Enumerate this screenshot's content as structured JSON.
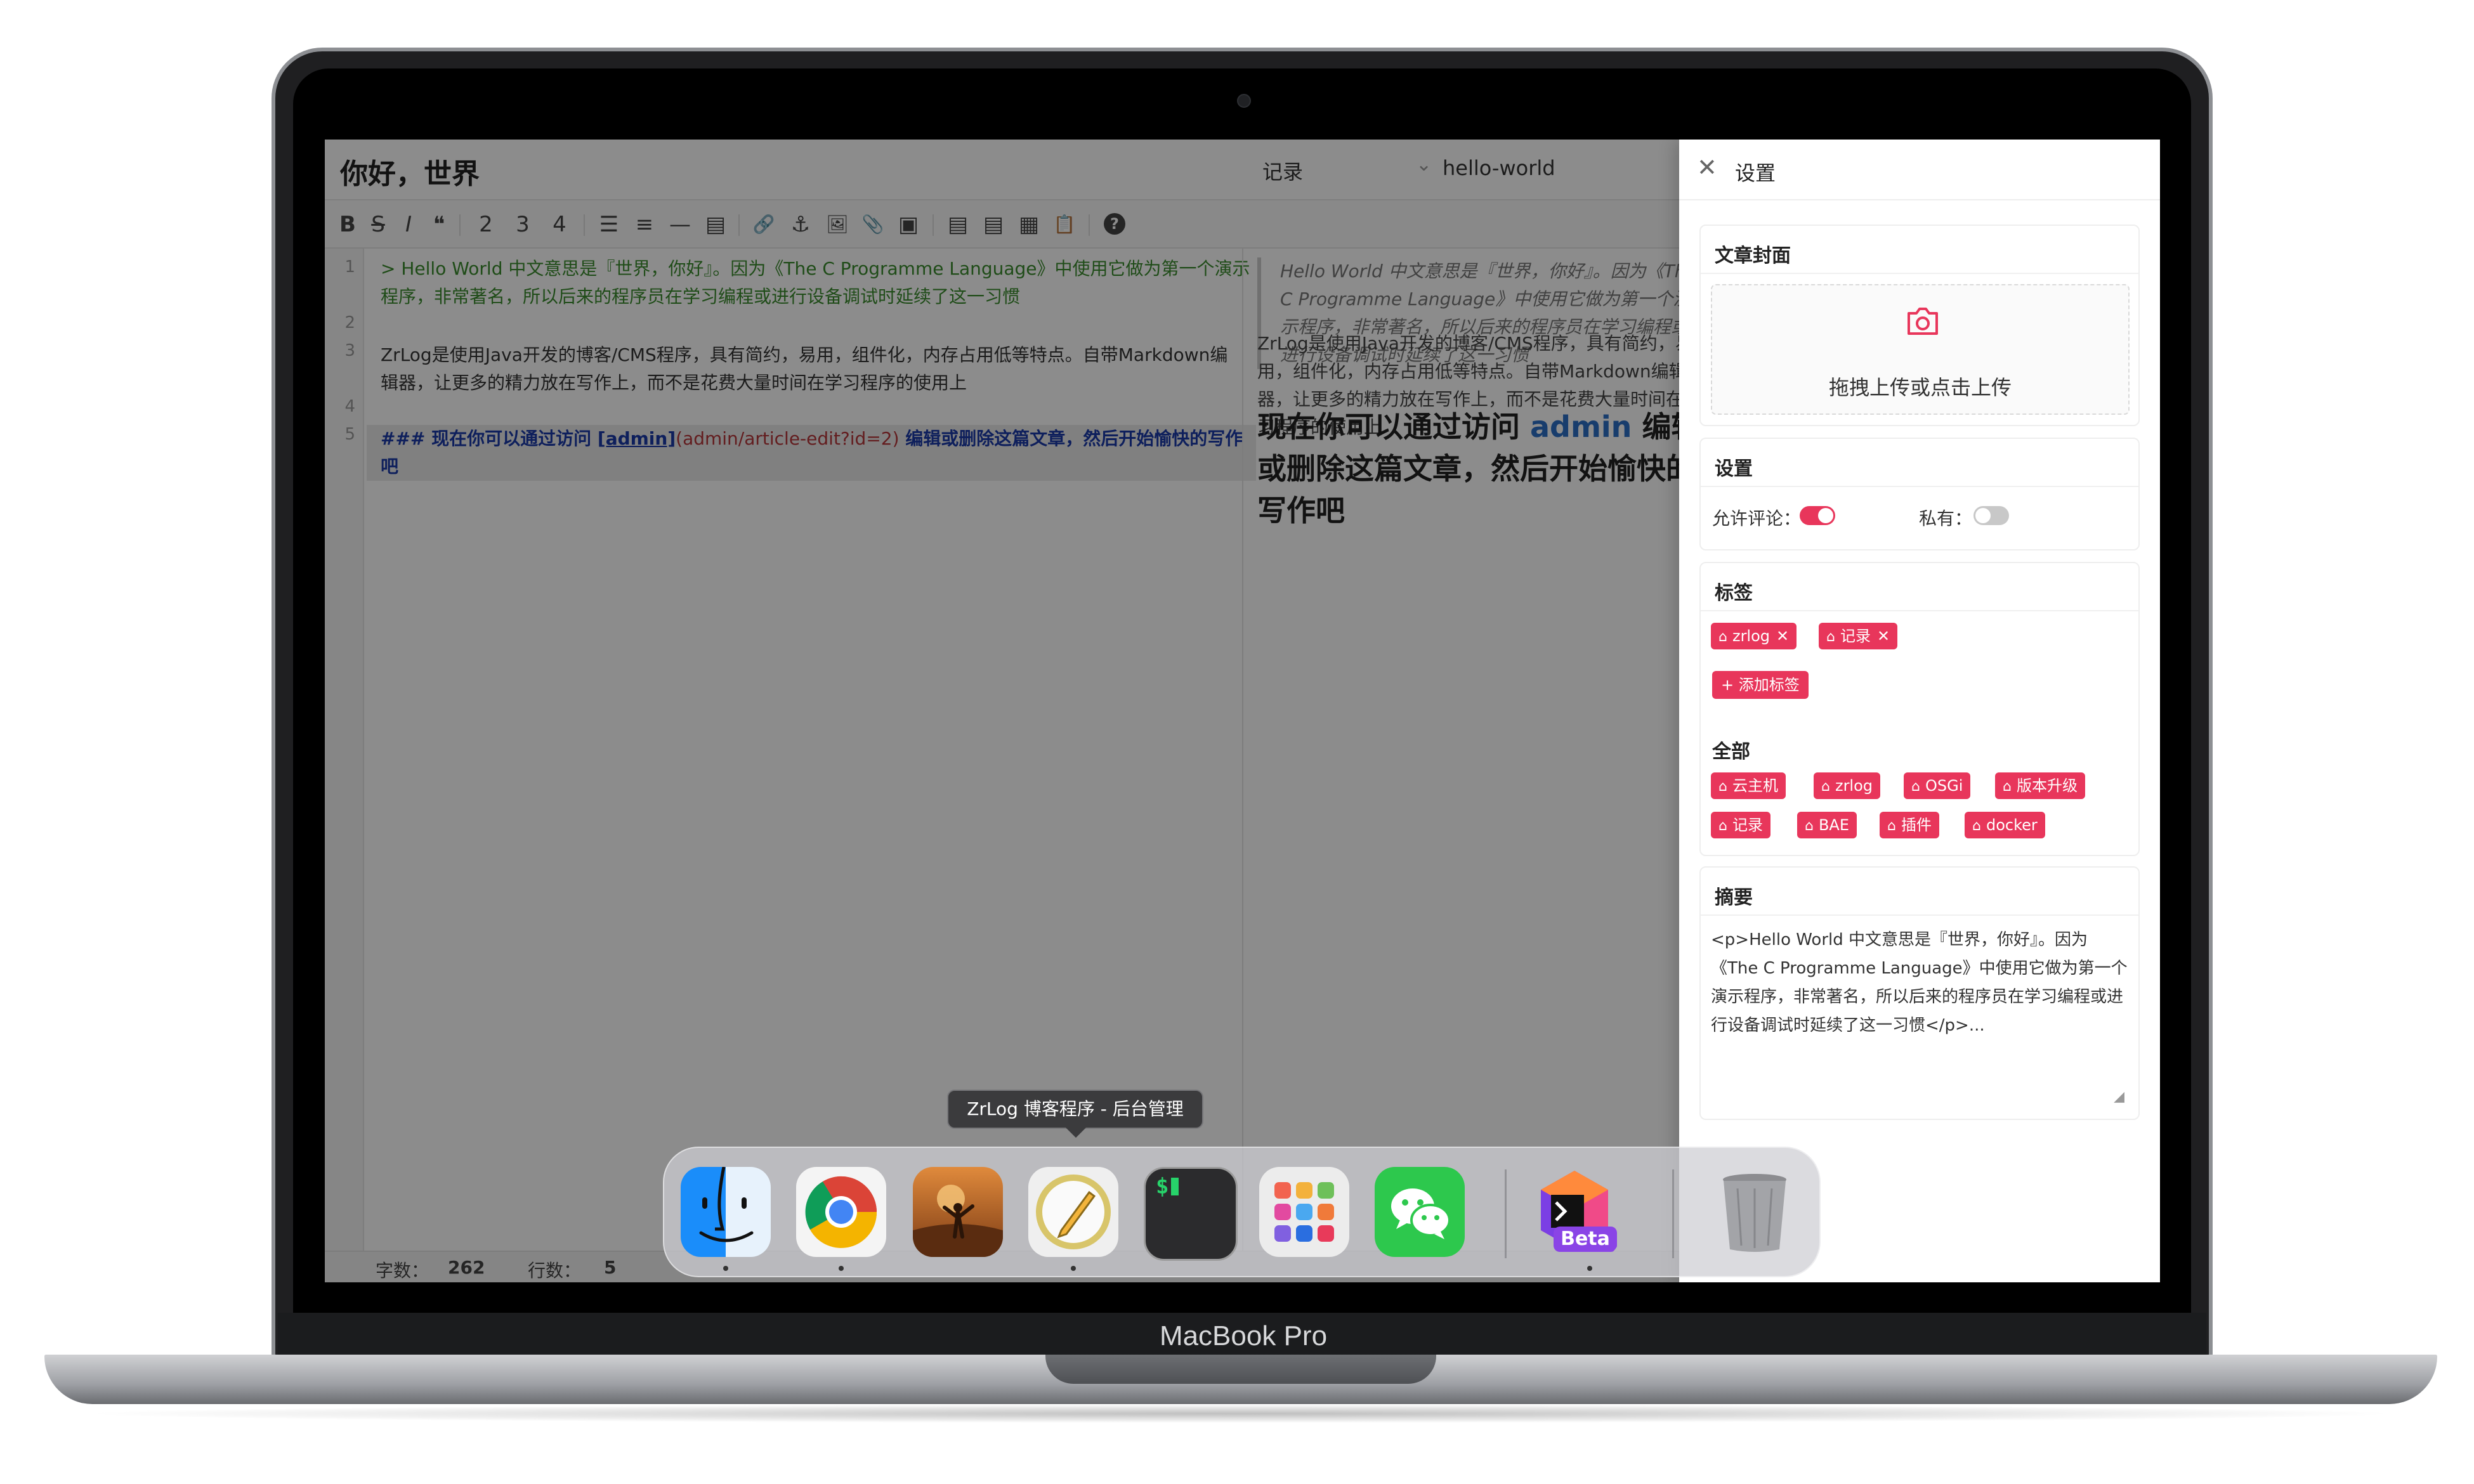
{
  "device": {
    "brand_label": "MacBook Pro"
  },
  "editor": {
    "title": "你好，世界",
    "category": "记录",
    "slug": "hello-world",
    "toolbar": [
      "B",
      "S",
      "I",
      "❝",
      "2",
      "3",
      "4",
      "☰",
      "≡",
      "—",
      "▤",
      "🔗",
      "⚓",
      "🖼",
      "📎",
      "▣",
      "▤",
      "▤",
      "▦",
      "📋",
      "?"
    ],
    "lines": [
      {
        "n": "1",
        "text": "> Hello World 中文意思是『世界，你好』。因为《The C Programme Language》中使用它做为第一个演示"
      },
      {
        "n": "",
        "text": "程序，非常著名，所以后来的程序员在学习编程或进行设备调试时延续了这一习惯"
      },
      {
        "n": "2",
        "text": ""
      },
      {
        "n": "3",
        "text": "ZrLog是使用Java开发的博客/CMS程序，具有简约，易用，组件化，内存占用低等特点。自带Markdown编"
      },
      {
        "n": "",
        "text": "辑器，让更多的精力放在写作上，而不是花费大量时间在学习程序的使用上"
      },
      {
        "n": "4",
        "text": ""
      },
      {
        "n": "5",
        "pre": "### 现在你可以通过访问 ",
        "link": "[admin]",
        "paren": "(admin/article-edit?id=2)",
        "post": " 编辑或删除这篇文章，然后开始愉快的写作吧"
      }
    ],
    "preview": {
      "quote": "Hello World 中文意思是『世界，你好』。因为《The C Programme Language》中使用它做为第一个演示程序，非常著名，所以后来的程序员在学习编程或进行设备调试时延续了这一习惯",
      "para": "ZrLog是使用Java开发的博客/CMS程序，具有简约，易用，组件化，内存占用低等特点。自带Markdown编辑器，让更多的精力放在写作上，而不是花费大量时间在学习程序的使用上",
      "h_pre": "现在你可以通过访问 ",
      "h_link": "admin",
      "h_post": " 编辑或删除这篇文章，然后开始愉快的写作吧"
    },
    "status": {
      "chars_label": "字数：",
      "chars": "262",
      "lines_label": "行数：",
      "lines": "5"
    }
  },
  "drawer": {
    "title": "设置",
    "cover": {
      "header": "文章封面",
      "upload_text": "拖拽上传或点击上传"
    },
    "settings": {
      "header": "设置",
      "allow_comment": "允许评论：",
      "allow_comment_on": true,
      "private": "私有：",
      "private_on": false
    },
    "tags": {
      "header": "标签",
      "selected": [
        "zrlog",
        "记录"
      ],
      "add_label": "+ 添加标签",
      "all_header": "全部",
      "all": [
        "云主机",
        "zrlog",
        "OSGi",
        "版本升级",
        "记录",
        "BAE",
        "插件",
        "docker"
      ]
    },
    "summary": {
      "header": "摘要",
      "text": "<p>Hello World 中文意思是『世界，你好』。因为《The C Programme Language》中使用它做为第一个演示程序，非常著名，所以后来的程序员在学习编程或进行设备调试时延续了这一习惯</p>..."
    }
  },
  "tooltip": "ZrLog 博客程序 - 后台管理",
  "dock": {
    "apps": [
      "finder",
      "chrome",
      "photo",
      "textedit",
      "terminal",
      "launchpad",
      "wechat",
      "toolbox-beta",
      "trash"
    ],
    "beta_label": "Beta",
    "terminal_prompt": "$"
  },
  "colors": {
    "accent": "#e8365b",
    "toggle_off": "#c8c8c8",
    "link": "#2c6fc7"
  }
}
